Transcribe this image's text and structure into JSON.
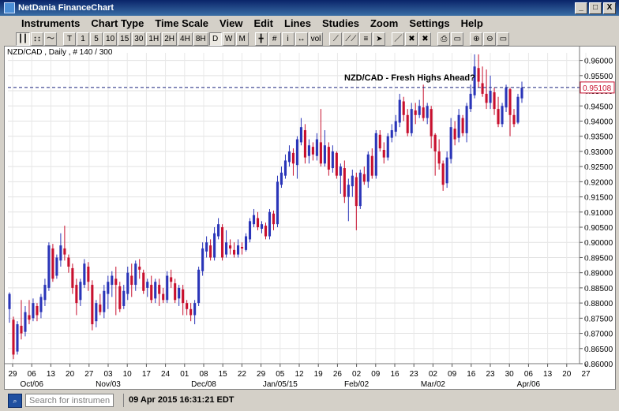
{
  "window": {
    "title": "NetDania FinanceChart",
    "minimize": "_",
    "maximize": "□",
    "close": "X"
  },
  "menu": [
    "Instruments",
    "Chart Type",
    "Time Scale",
    "View",
    "Edit",
    "Lines",
    "Studies",
    "Zoom",
    "Settings",
    "Help"
  ],
  "toolbar": {
    "chart_types": [
      {
        "icon": "candle-icon",
        "label": "┃┃"
      },
      {
        "icon": "ohlc-icon",
        "label": "↕↕"
      },
      {
        "icon": "line-chart-icon",
        "label": "〜"
      }
    ],
    "timescales": [
      "T",
      "1",
      "5",
      "10",
      "15",
      "30",
      "1H",
      "2H",
      "4H",
      "8H",
      "D",
      "W",
      "M"
    ],
    "active_timescale": "D",
    "tools": [
      {
        "name": "crosshair-icon",
        "label": "╋"
      },
      {
        "name": "grid-icon",
        "label": "#"
      },
      {
        "name": "info-icon",
        "label": "i"
      },
      {
        "name": "scroll-icon",
        "label": "↔"
      },
      {
        "name": "volume-icon",
        "label": "vol"
      },
      {
        "name": "trendline-icon",
        "label": "⟋"
      },
      {
        "name": "channel-icon",
        "label": "⟋⟋"
      },
      {
        "name": "fibonacci-icon",
        "label": "≡"
      },
      {
        "name": "arrow-icon",
        "label": "➤"
      },
      {
        "name": "draw-line-icon",
        "label": "／"
      },
      {
        "name": "delete-icon",
        "label": "✖"
      },
      {
        "name": "delete-all-icon",
        "label": "✖"
      },
      {
        "name": "print-icon",
        "label": "⎙"
      },
      {
        "name": "print-preview-icon",
        "label": "▭"
      },
      {
        "name": "zoom-in-icon",
        "label": "⊕"
      },
      {
        "name": "zoom-out-icon",
        "label": "⊖"
      },
      {
        "name": "zoom-reset-icon",
        "label": "▭"
      }
    ]
  },
  "chart_header": "NZD/CAD , Daily , # 140 / 300",
  "annotation": "NZD/CAD - Fresh Highs Ahead?",
  "colors": {
    "up": "#2a35b8",
    "down": "#c8102e",
    "dashed": "#1a237e",
    "last_box": "#c8102e"
  },
  "chart_data": {
    "type": "candlestick",
    "instrument": "NZD/CAD",
    "period": "Daily",
    "ylim": [
      0.86,
      0.9625
    ],
    "y_ticks": [
      "0.86000",
      "0.86500",
      "0.87000",
      "0.87500",
      "0.88000",
      "0.88500",
      "0.89000",
      "0.89500",
      "0.90000",
      "0.90500",
      "0.91000",
      "0.91500",
      "0.92000",
      "0.92500",
      "0.93000",
      "0.93500",
      "0.94000",
      "0.94500",
      "0.95000",
      "0.95500",
      "0.96000"
    ],
    "last_price": "0.95108",
    "x_day_ticks": [
      "29",
      "06",
      "13",
      "20",
      "27",
      "03",
      "10",
      "17",
      "24",
      "01",
      "08",
      "15",
      "22",
      "29",
      "05",
      "12",
      "19",
      "26",
      "02",
      "09",
      "16",
      "23",
      "02",
      "09",
      "16",
      "23",
      "30",
      "06",
      "13",
      "20",
      "27"
    ],
    "x_month_labels": [
      {
        "label": "Oct/06",
        "tick": 1
      },
      {
        "label": "Nov/03",
        "tick": 5
      },
      {
        "label": "Dec/08",
        "tick": 10
      },
      {
        "label": "Jan/05/15",
        "tick": 14
      },
      {
        "label": "Feb/02",
        "tick": 18
      },
      {
        "label": "Mar/02",
        "tick": 22
      },
      {
        "label": "Apr/06",
        "tick": 27
      }
    ],
    "candles": [
      [
        0.878,
        0.883,
        0.8735,
        0.8835
      ],
      [
        0.8745,
        0.863,
        0.8615,
        0.8755
      ],
      [
        0.864,
        0.873,
        0.863,
        0.874
      ],
      [
        0.8725,
        0.87,
        0.868,
        0.881
      ],
      [
        0.8705,
        0.877,
        0.869,
        0.879
      ],
      [
        0.876,
        0.8745,
        0.873,
        0.881
      ],
      [
        0.875,
        0.88,
        0.874,
        0.8815
      ],
      [
        0.879,
        0.876,
        0.874,
        0.88
      ],
      [
        0.877,
        0.882,
        0.875,
        0.883
      ],
      [
        0.881,
        0.886,
        0.879,
        0.888
      ],
      [
        0.885,
        0.899,
        0.884,
        0.9
      ],
      [
        0.898,
        0.888,
        0.887,
        0.8995
      ],
      [
        0.889,
        0.895,
        0.888,
        0.896
      ],
      [
        0.894,
        0.899,
        0.892,
        0.903
      ],
      [
        0.898,
        0.896,
        0.894,
        0.9055
      ],
      [
        0.895,
        0.892,
        0.89,
        0.896
      ],
      [
        0.8915,
        0.885,
        0.883,
        0.893
      ],
      [
        0.886,
        0.88,
        0.876,
        0.888
      ],
      [
        0.881,
        0.887,
        0.879,
        0.888
      ],
      [
        0.886,
        0.893,
        0.885,
        0.8945
      ],
      [
        0.892,
        0.887,
        0.884,
        0.8935
      ],
      [
        0.886,
        0.873,
        0.871,
        0.8875
      ],
      [
        0.874,
        0.88,
        0.872,
        0.881
      ],
      [
        0.8795,
        0.877,
        0.876,
        0.883
      ],
      [
        0.877,
        0.884,
        0.875,
        0.886
      ],
      [
        0.883,
        0.887,
        0.878,
        0.889
      ],
      [
        0.886,
        0.889,
        0.882,
        0.8905
      ],
      [
        0.888,
        0.886,
        0.876,
        0.892
      ],
      [
        0.8855,
        0.878,
        0.877,
        0.887
      ],
      [
        0.879,
        0.884,
        0.878,
        0.886
      ],
      [
        0.883,
        0.89,
        0.881,
        0.892
      ],
      [
        0.889,
        0.886,
        0.882,
        0.893
      ],
      [
        0.886,
        0.893,
        0.884,
        0.894
      ],
      [
        0.892,
        0.891,
        0.888,
        0.8945
      ],
      [
        0.89,
        0.884,
        0.883,
        0.891
      ],
      [
        0.885,
        0.887,
        0.882,
        0.888
      ],
      [
        0.886,
        0.881,
        0.88,
        0.889
      ],
      [
        0.8815,
        0.887,
        0.88,
        0.888
      ],
      [
        0.886,
        0.883,
        0.879,
        0.888
      ],
      [
        0.883,
        0.881,
        0.88,
        0.885
      ],
      [
        0.881,
        0.889,
        0.88,
        0.8905
      ],
      [
        0.8885,
        0.887,
        0.885,
        0.891
      ],
      [
        0.8865,
        0.881,
        0.88,
        0.888
      ],
      [
        0.8815,
        0.885,
        0.879,
        0.886
      ],
      [
        0.8845,
        0.88,
        0.876,
        0.886
      ],
      [
        0.88,
        0.878,
        0.876,
        0.881
      ],
      [
        0.878,
        0.876,
        0.874,
        0.88
      ],
      [
        0.876,
        0.88,
        0.873,
        0.881
      ],
      [
        0.88,
        0.891,
        0.879,
        0.892
      ],
      [
        0.8905,
        0.898,
        0.889,
        0.9
      ],
      [
        0.897,
        0.9,
        0.895,
        0.902
      ],
      [
        0.899,
        0.895,
        0.894,
        0.901
      ],
      [
        0.895,
        0.903,
        0.894,
        0.905
      ],
      [
        0.902,
        0.906,
        0.901,
        0.908
      ],
      [
        0.905,
        0.895,
        0.894,
        0.906
      ],
      [
        0.896,
        0.9,
        0.895,
        0.904
      ],
      [
        0.899,
        0.898,
        0.896,
        0.901
      ],
      [
        0.8975,
        0.896,
        0.895,
        0.9
      ],
      [
        0.896,
        0.899,
        0.895,
        0.901
      ],
      [
        0.8985,
        0.898,
        0.896,
        0.9
      ],
      [
        0.8975,
        0.902,
        0.897,
        0.903
      ],
      [
        0.901,
        0.907,
        0.9,
        0.908
      ],
      [
        0.906,
        0.909,
        0.905,
        0.911
      ],
      [
        0.908,
        0.905,
        0.904,
        0.91
      ],
      [
        0.9045,
        0.906,
        0.903,
        0.907
      ],
      [
        0.9055,
        0.902,
        0.901,
        0.9065
      ],
      [
        0.902,
        0.91,
        0.901,
        0.911
      ],
      [
        0.9095,
        0.906,
        0.904,
        0.9105
      ],
      [
        0.906,
        0.92,
        0.905,
        0.922
      ],
      [
        0.919,
        0.923,
        0.918,
        0.925
      ],
      [
        0.922,
        0.927,
        0.921,
        0.929
      ],
      [
        0.9265,
        0.93,
        0.925,
        0.932
      ],
      [
        0.9295,
        0.926,
        0.922,
        0.931
      ],
      [
        0.9255,
        0.934,
        0.921,
        0.935
      ],
      [
        0.933,
        0.938,
        0.932,
        0.941
      ],
      [
        0.937,
        0.928,
        0.926,
        0.939
      ],
      [
        0.9285,
        0.932,
        0.926,
        0.934
      ],
      [
        0.9315,
        0.929,
        0.927,
        0.933
      ],
      [
        0.9285,
        0.934,
        0.927,
        0.936
      ],
      [
        0.933,
        0.926,
        0.925,
        0.944
      ],
      [
        0.926,
        0.932,
        0.925,
        0.937
      ],
      [
        0.9315,
        0.924,
        0.922,
        0.933
      ],
      [
        0.9245,
        0.93,
        0.923,
        0.932
      ],
      [
        0.9295,
        0.922,
        0.921,
        0.93
      ],
      [
        0.922,
        0.925,
        0.916,
        0.926
      ],
      [
        0.9245,
        0.915,
        0.913,
        0.927
      ],
      [
        0.915,
        0.919,
        0.907,
        0.921
      ],
      [
        0.9185,
        0.922,
        0.915,
        0.924
      ],
      [
        0.9215,
        0.912,
        0.904,
        0.923
      ],
      [
        0.912,
        0.923,
        0.911,
        0.924
      ],
      [
        0.9225,
        0.92,
        0.919,
        0.925
      ],
      [
        0.92,
        0.929,
        0.918,
        0.93
      ],
      [
        0.9285,
        0.922,
        0.921,
        0.931
      ],
      [
        0.922,
        0.936,
        0.921,
        0.937
      ],
      [
        0.9355,
        0.931,
        0.93,
        0.937
      ],
      [
        0.9305,
        0.928,
        0.926,
        0.933
      ],
      [
        0.928,
        0.935,
        0.927,
        0.936
      ],
      [
        0.9345,
        0.937,
        0.933,
        0.939
      ],
      [
        0.9365,
        0.94,
        0.935,
        0.942
      ],
      [
        0.9395,
        0.947,
        0.938,
        0.949
      ],
      [
        0.9465,
        0.942,
        0.94,
        0.948
      ],
      [
        0.942,
        0.936,
        0.935,
        0.944
      ],
      [
        0.936,
        0.944,
        0.935,
        0.946
      ],
      [
        0.9435,
        0.942,
        0.939,
        0.946
      ],
      [
        0.942,
        0.945,
        0.941,
        0.947
      ],
      [
        0.9445,
        0.941,
        0.94,
        0.952
      ],
      [
        0.941,
        0.945,
        0.939,
        0.946
      ],
      [
        0.944,
        0.935,
        0.931,
        0.945
      ],
      [
        0.9355,
        0.93,
        0.922,
        0.936
      ],
      [
        0.93,
        0.926,
        0.924,
        0.934
      ],
      [
        0.926,
        0.919,
        0.917,
        0.927
      ],
      [
        0.9195,
        0.928,
        0.918,
        0.93
      ],
      [
        0.9275,
        0.938,
        0.926,
        0.941
      ],
      [
        0.9375,
        0.934,
        0.932,
        0.94
      ],
      [
        0.9345,
        0.942,
        0.933,
        0.944
      ],
      [
        0.941,
        0.936,
        0.935,
        0.942
      ],
      [
        0.936,
        0.945,
        0.933,
        0.946
      ],
      [
        0.944,
        0.949,
        0.943,
        0.952
      ],
      [
        0.9485,
        0.958,
        0.9475,
        0.962
      ],
      [
        0.9575,
        0.953,
        0.951,
        0.962
      ],
      [
        0.9525,
        0.949,
        0.948,
        0.958
      ],
      [
        0.949,
        0.946,
        0.944,
        0.957
      ],
      [
        0.946,
        0.95,
        0.944,
        0.955
      ],
      [
        0.9495,
        0.944,
        0.942,
        0.951
      ],
      [
        0.944,
        0.939,
        0.938,
        0.948
      ],
      [
        0.939,
        0.945,
        0.938,
        0.946
      ],
      [
        0.9445,
        0.951,
        0.943,
        0.952
      ],
      [
        0.9505,
        0.942,
        0.935,
        0.951
      ],
      [
        0.942,
        0.939,
        0.938,
        0.944
      ],
      [
        0.9395,
        0.948,
        0.939,
        0.949
      ],
      [
        0.9475,
        0.951,
        0.946,
        0.953
      ]
    ]
  },
  "status": {
    "search_placeholder": "Search for instrument",
    "datetime": "09 Apr 2015 16:31:21 EDT"
  }
}
